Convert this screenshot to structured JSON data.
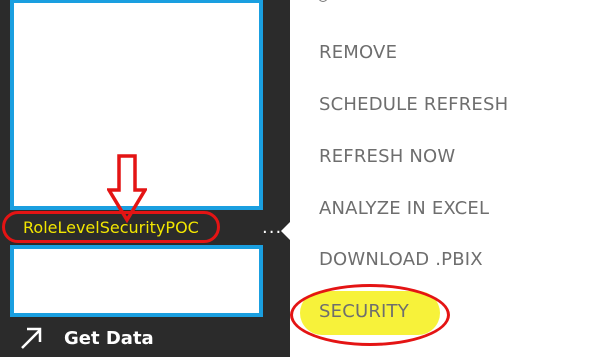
{
  "nav": {
    "dataset_name": "RoleLevelSecurityPOC",
    "more_options": "...",
    "get_data_label": "Get Data"
  },
  "context_menu": {
    "items": [
      {
        "label": "REMOVE"
      },
      {
        "label": "SCHEDULE REFRESH"
      },
      {
        "label": "REFRESH NOW"
      },
      {
        "label": "ANALYZE IN EXCEL"
      },
      {
        "label": "DOWNLOAD .PBIX"
      },
      {
        "label": "SECURITY"
      }
    ]
  },
  "colors": {
    "nav_background": "#2b2b2b",
    "tile_border": "#1a9fe0",
    "dataset_text": "#f2e600",
    "annotation_red": "#e41414",
    "highlight_yellow": "#f7f23a",
    "menu_text": "#6e6e6e"
  }
}
